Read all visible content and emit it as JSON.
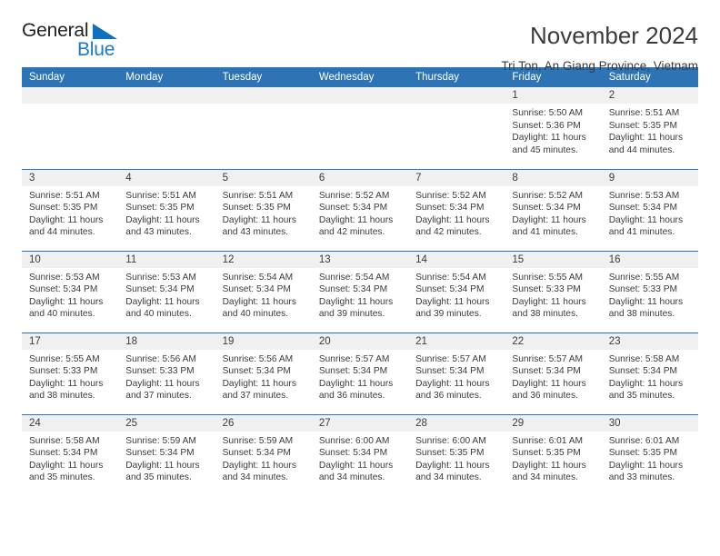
{
  "brand": {
    "name_top": "General",
    "name_bottom": "Blue",
    "triangle_icon": "blue-triangle-icon",
    "color_dark": "#231f20",
    "color_blue": "#1b7ac4"
  },
  "header": {
    "title": "November 2024",
    "subtitle": "Tri Ton, An Giang Province, Vietnam"
  },
  "theme": {
    "header_blue": "#2e74b5",
    "daynum_band": "#f0f0f0",
    "text": "#3b3b3b"
  },
  "weekday_headers": [
    "Sunday",
    "Monday",
    "Tuesday",
    "Wednesday",
    "Thursday",
    "Friday",
    "Saturday"
  ],
  "weeks": [
    [
      {
        "day": "",
        "sunrise": "",
        "sunset": "",
        "daylight_line1": "",
        "daylight_line2": ""
      },
      {
        "day": "",
        "sunrise": "",
        "sunset": "",
        "daylight_line1": "",
        "daylight_line2": ""
      },
      {
        "day": "",
        "sunrise": "",
        "sunset": "",
        "daylight_line1": "",
        "daylight_line2": ""
      },
      {
        "day": "",
        "sunrise": "",
        "sunset": "",
        "daylight_line1": "",
        "daylight_line2": ""
      },
      {
        "day": "",
        "sunrise": "",
        "sunset": "",
        "daylight_line1": "",
        "daylight_line2": ""
      },
      {
        "day": "1",
        "sunrise": "Sunrise: 5:50 AM",
        "sunset": "Sunset: 5:36 PM",
        "daylight_line1": "Daylight: 11 hours",
        "daylight_line2": "and 45 minutes."
      },
      {
        "day": "2",
        "sunrise": "Sunrise: 5:51 AM",
        "sunset": "Sunset: 5:35 PM",
        "daylight_line1": "Daylight: 11 hours",
        "daylight_line2": "and 44 minutes."
      }
    ],
    [
      {
        "day": "3",
        "sunrise": "Sunrise: 5:51 AM",
        "sunset": "Sunset: 5:35 PM",
        "daylight_line1": "Daylight: 11 hours",
        "daylight_line2": "and 44 minutes."
      },
      {
        "day": "4",
        "sunrise": "Sunrise: 5:51 AM",
        "sunset": "Sunset: 5:35 PM",
        "daylight_line1": "Daylight: 11 hours",
        "daylight_line2": "and 43 minutes."
      },
      {
        "day": "5",
        "sunrise": "Sunrise: 5:51 AM",
        "sunset": "Sunset: 5:35 PM",
        "daylight_line1": "Daylight: 11 hours",
        "daylight_line2": "and 43 minutes."
      },
      {
        "day": "6",
        "sunrise": "Sunrise: 5:52 AM",
        "sunset": "Sunset: 5:34 PM",
        "daylight_line1": "Daylight: 11 hours",
        "daylight_line2": "and 42 minutes."
      },
      {
        "day": "7",
        "sunrise": "Sunrise: 5:52 AM",
        "sunset": "Sunset: 5:34 PM",
        "daylight_line1": "Daylight: 11 hours",
        "daylight_line2": "and 42 minutes."
      },
      {
        "day": "8",
        "sunrise": "Sunrise: 5:52 AM",
        "sunset": "Sunset: 5:34 PM",
        "daylight_line1": "Daylight: 11 hours",
        "daylight_line2": "and 41 minutes."
      },
      {
        "day": "9",
        "sunrise": "Sunrise: 5:53 AM",
        "sunset": "Sunset: 5:34 PM",
        "daylight_line1": "Daylight: 11 hours",
        "daylight_line2": "and 41 minutes."
      }
    ],
    [
      {
        "day": "10",
        "sunrise": "Sunrise: 5:53 AM",
        "sunset": "Sunset: 5:34 PM",
        "daylight_line1": "Daylight: 11 hours",
        "daylight_line2": "and 40 minutes."
      },
      {
        "day": "11",
        "sunrise": "Sunrise: 5:53 AM",
        "sunset": "Sunset: 5:34 PM",
        "daylight_line1": "Daylight: 11 hours",
        "daylight_line2": "and 40 minutes."
      },
      {
        "day": "12",
        "sunrise": "Sunrise: 5:54 AM",
        "sunset": "Sunset: 5:34 PM",
        "daylight_line1": "Daylight: 11 hours",
        "daylight_line2": "and 40 minutes."
      },
      {
        "day": "13",
        "sunrise": "Sunrise: 5:54 AM",
        "sunset": "Sunset: 5:34 PM",
        "daylight_line1": "Daylight: 11 hours",
        "daylight_line2": "and 39 minutes."
      },
      {
        "day": "14",
        "sunrise": "Sunrise: 5:54 AM",
        "sunset": "Sunset: 5:34 PM",
        "daylight_line1": "Daylight: 11 hours",
        "daylight_line2": "and 39 minutes."
      },
      {
        "day": "15",
        "sunrise": "Sunrise: 5:55 AM",
        "sunset": "Sunset: 5:33 PM",
        "daylight_line1": "Daylight: 11 hours",
        "daylight_line2": "and 38 minutes."
      },
      {
        "day": "16",
        "sunrise": "Sunrise: 5:55 AM",
        "sunset": "Sunset: 5:33 PM",
        "daylight_line1": "Daylight: 11 hours",
        "daylight_line2": "and 38 minutes."
      }
    ],
    [
      {
        "day": "17",
        "sunrise": "Sunrise: 5:55 AM",
        "sunset": "Sunset: 5:33 PM",
        "daylight_line1": "Daylight: 11 hours",
        "daylight_line2": "and 38 minutes."
      },
      {
        "day": "18",
        "sunrise": "Sunrise: 5:56 AM",
        "sunset": "Sunset: 5:33 PM",
        "daylight_line1": "Daylight: 11 hours",
        "daylight_line2": "and 37 minutes."
      },
      {
        "day": "19",
        "sunrise": "Sunrise: 5:56 AM",
        "sunset": "Sunset: 5:34 PM",
        "daylight_line1": "Daylight: 11 hours",
        "daylight_line2": "and 37 minutes."
      },
      {
        "day": "20",
        "sunrise": "Sunrise: 5:57 AM",
        "sunset": "Sunset: 5:34 PM",
        "daylight_line1": "Daylight: 11 hours",
        "daylight_line2": "and 36 minutes."
      },
      {
        "day": "21",
        "sunrise": "Sunrise: 5:57 AM",
        "sunset": "Sunset: 5:34 PM",
        "daylight_line1": "Daylight: 11 hours",
        "daylight_line2": "and 36 minutes."
      },
      {
        "day": "22",
        "sunrise": "Sunrise: 5:57 AM",
        "sunset": "Sunset: 5:34 PM",
        "daylight_line1": "Daylight: 11 hours",
        "daylight_line2": "and 36 minutes."
      },
      {
        "day": "23",
        "sunrise": "Sunrise: 5:58 AM",
        "sunset": "Sunset: 5:34 PM",
        "daylight_line1": "Daylight: 11 hours",
        "daylight_line2": "and 35 minutes."
      }
    ],
    [
      {
        "day": "24",
        "sunrise": "Sunrise: 5:58 AM",
        "sunset": "Sunset: 5:34 PM",
        "daylight_line1": "Daylight: 11 hours",
        "daylight_line2": "and 35 minutes."
      },
      {
        "day": "25",
        "sunrise": "Sunrise: 5:59 AM",
        "sunset": "Sunset: 5:34 PM",
        "daylight_line1": "Daylight: 11 hours",
        "daylight_line2": "and 35 minutes."
      },
      {
        "day": "26",
        "sunrise": "Sunrise: 5:59 AM",
        "sunset": "Sunset: 5:34 PM",
        "daylight_line1": "Daylight: 11 hours",
        "daylight_line2": "and 34 minutes."
      },
      {
        "day": "27",
        "sunrise": "Sunrise: 6:00 AM",
        "sunset": "Sunset: 5:34 PM",
        "daylight_line1": "Daylight: 11 hours",
        "daylight_line2": "and 34 minutes."
      },
      {
        "day": "28",
        "sunrise": "Sunrise: 6:00 AM",
        "sunset": "Sunset: 5:35 PM",
        "daylight_line1": "Daylight: 11 hours",
        "daylight_line2": "and 34 minutes."
      },
      {
        "day": "29",
        "sunrise": "Sunrise: 6:01 AM",
        "sunset": "Sunset: 5:35 PM",
        "daylight_line1": "Daylight: 11 hours",
        "daylight_line2": "and 34 minutes."
      },
      {
        "day": "30",
        "sunrise": "Sunrise: 6:01 AM",
        "sunset": "Sunset: 5:35 PM",
        "daylight_line1": "Daylight: 11 hours",
        "daylight_line2": "and 33 minutes."
      }
    ]
  ]
}
